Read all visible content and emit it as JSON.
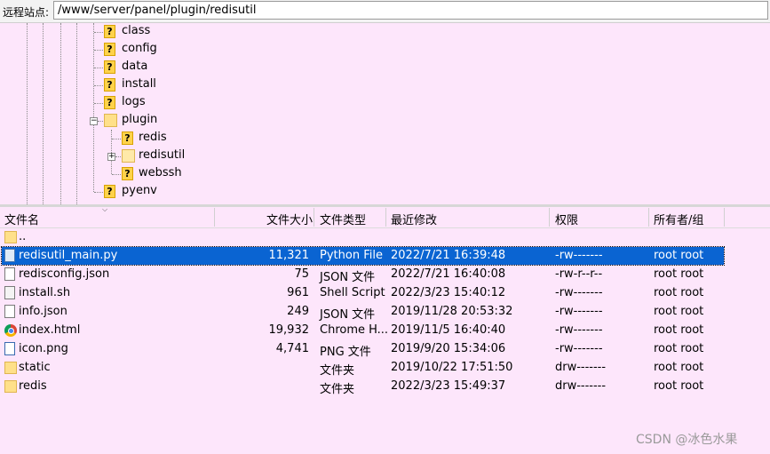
{
  "topbar": {
    "label": "远程站点:",
    "path": "/www/server/panel/plugin/redisutil"
  },
  "tree": {
    "items": [
      {
        "label": "class"
      },
      {
        "label": "config"
      },
      {
        "label": "data"
      },
      {
        "label": "install"
      },
      {
        "label": "logs"
      },
      {
        "label": "plugin"
      },
      {
        "label": "redis"
      },
      {
        "label": "redisutil"
      },
      {
        "label": "webssh"
      },
      {
        "label": "pyenv"
      }
    ],
    "unknown_glyph": "?",
    "collapse_glyph": "−",
    "expand_glyph": "+"
  },
  "columns": {
    "name": "文件名",
    "size": "文件大小",
    "type": "文件类型",
    "modified": "最近修改",
    "perms": "权限",
    "owner": "所有者/组"
  },
  "files": [
    {
      "name": "..",
      "size": "",
      "type": "",
      "modified": "",
      "perms": "",
      "owner": "",
      "icon": "folder-icon"
    },
    {
      "name": "redisutil_main.py",
      "size": "11,321",
      "type": "Python File",
      "modified": "2022/7/21 16:39:48",
      "perms": "-rw-------",
      "owner": "root root",
      "icon": "python-file-icon",
      "selected": true
    },
    {
      "name": "redisconfig.json",
      "size": "75",
      "type": "JSON 文件",
      "modified": "2022/7/21 16:40:08",
      "perms": "-rw-r--r--",
      "owner": "root root",
      "icon": "file-icon"
    },
    {
      "name": "install.sh",
      "size": "961",
      "type": "Shell Script",
      "modified": "2022/3/23 15:40:12",
      "perms": "-rw-------",
      "owner": "root root",
      "icon": "shell-script-icon"
    },
    {
      "name": "info.json",
      "size": "249",
      "type": "JSON 文件",
      "modified": "2019/11/28 20:53:32",
      "perms": "-rw-------",
      "owner": "root root",
      "icon": "file-icon"
    },
    {
      "name": "index.html",
      "size": "19,932",
      "type": "Chrome H...",
      "modified": "2019/11/5 16:40:40",
      "perms": "-rw-------",
      "owner": "root root",
      "icon": "chrome-icon"
    },
    {
      "name": "icon.png",
      "size": "4,741",
      "type": "PNG 文件",
      "modified": "2019/9/20 15:34:06",
      "perms": "-rw-------",
      "owner": "root root",
      "icon": "image-file-icon"
    },
    {
      "name": "static",
      "size": "",
      "type": "文件夹",
      "modified": "2019/10/22 17:51:50",
      "perms": "drw-------",
      "owner": "root root",
      "icon": "folder-icon"
    },
    {
      "name": "redis",
      "size": "",
      "type": "文件夹",
      "modified": "2022/3/23 15:49:37",
      "perms": "drw-------",
      "owner": "root root",
      "icon": "folder-icon"
    }
  ],
  "watermark": "CSDN @冰色水果",
  "colors": {
    "background": "#fde6fb",
    "selection": "#0a64d2"
  }
}
